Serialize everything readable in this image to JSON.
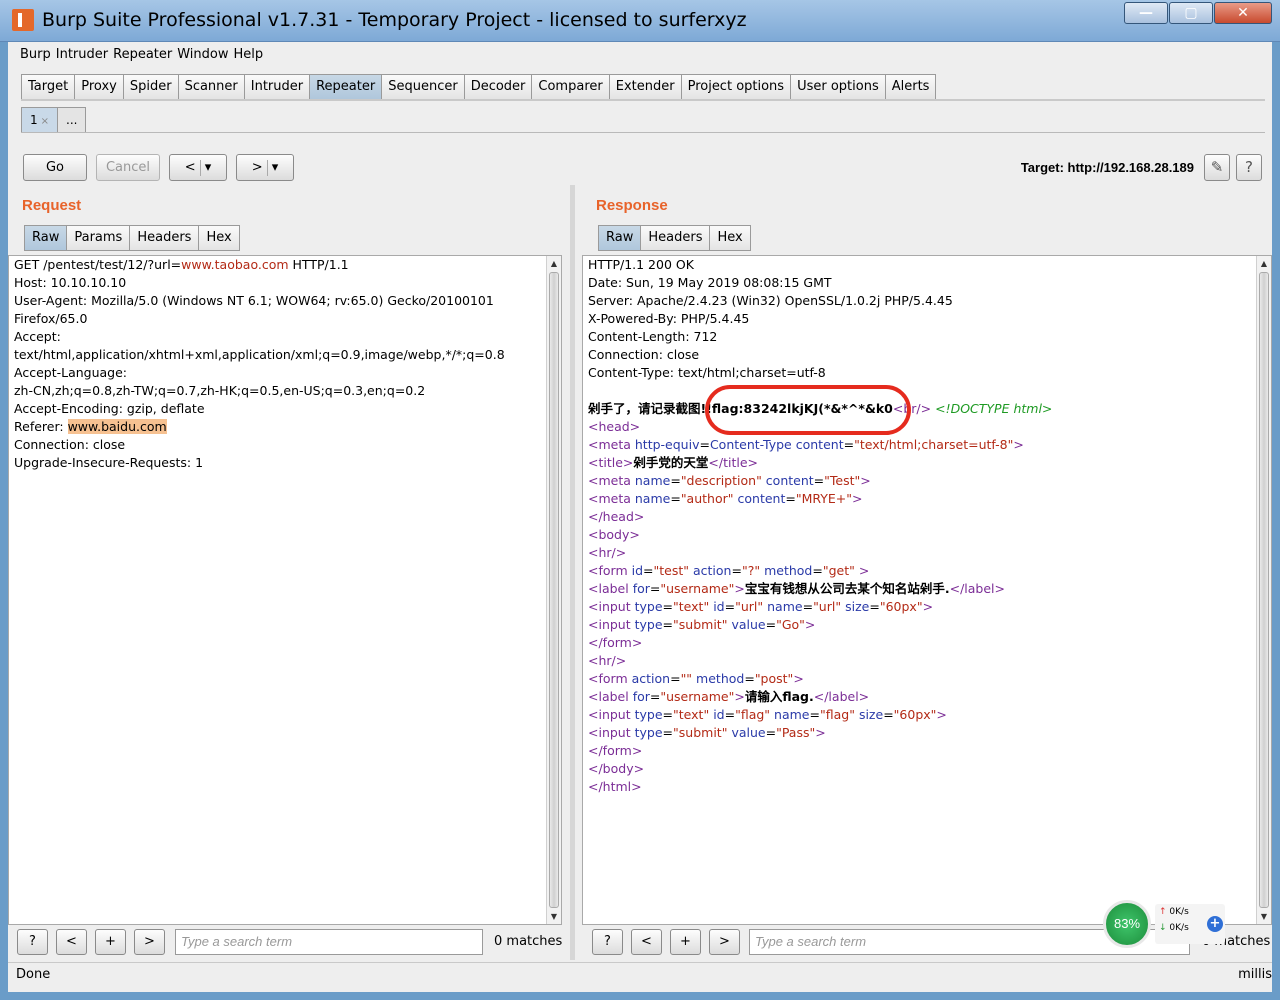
{
  "window": {
    "title": "Burp Suite Professional v1.7.31 - Temporary Project - licensed to surferxyz"
  },
  "menu": [
    "Burp",
    "Intruder",
    "Repeater",
    "Window",
    "Help"
  ],
  "main_tabs": [
    "Target",
    "Proxy",
    "Spider",
    "Scanner",
    "Intruder",
    "Repeater",
    "Sequencer",
    "Decoder",
    "Comparer",
    "Extender",
    "Project options",
    "User options",
    "Alerts"
  ],
  "active_main_tab": "Repeater",
  "sub_tabs": {
    "first": "1",
    "first_close": "×",
    "more": "..."
  },
  "toolbar": {
    "go": "Go",
    "cancel": "Cancel",
    "back": "<",
    "forward": ">",
    "dropdown": "▾",
    "target": "Target: http://192.168.28.189",
    "edit_icon": "✎",
    "help_icon": "?"
  },
  "request": {
    "title": "Request",
    "tabs": [
      "Raw",
      "Params",
      "Headers",
      "Hex"
    ],
    "lines": [
      "GET /pentest/test/12/?url=www.taobao.com HTTP/1.1",
      "Host: 10.10.10.10",
      "User-Agent: Mozilla/5.0 (Windows NT 6.1; WOW64; rv:65.0) Gecko/20100101",
      "Firefox/65.0",
      "Accept:",
      "text/html,application/xhtml+xml,application/xml;q=0.9,image/webp,*/*;q=0.8",
      "Accept-Language:",
      "zh-CN,zh;q=0.8,zh-TW;q=0.7,zh-HK;q=0.5,en-US;q=0.3,en;q=0.2",
      "Accept-Encoding: gzip, deflate",
      "Referer: www.baidu.com",
      "Connection: close",
      "Upgrade-Insecure-Requests: 1"
    ],
    "first_line": {
      "prefix": "GET /pentest/test/12/?url=",
      "param_value": "www.taobao.com",
      "suffix": " HTTP/1.1"
    },
    "referer": {
      "label": "Referer: ",
      "value": "www.baidu.com"
    },
    "search_placeholder": "Type a search term",
    "matches": "0 matches"
  },
  "response": {
    "title": "Response",
    "tabs": [
      "Raw",
      "Headers",
      "Hex"
    ],
    "headers": [
      "HTTP/1.1 200 OK",
      "Date: Sun, 19 May 2019 08:08:15 GMT",
      "Server: Apache/2.4.23 (Win32) OpenSSL/1.0.2j PHP/5.4.45",
      "X-Powered-By: PHP/5.4.45",
      "Content-Length: 712",
      "Connection: close",
      "Content-Type: text/html;charset=utf-8"
    ],
    "flag_line": {
      "cn": "剁手了，请记录截图!!",
      "flag": "flag:83242lkjKJ(*&*^*&k0",
      "br": "<br/>",
      "doctype": "<!DOCTYPE html>"
    },
    "title_text": "剁手党的天堂",
    "label1_text": "宝宝有钱想从公司去某个知名站剁手.",
    "label2_text": "请输入flag.",
    "search_placeholder": "Type a search term",
    "matches": "0 matches"
  },
  "bottom_buttons": {
    "help": "?",
    "prev": "<",
    "add": "+",
    "next": ">"
  },
  "status": {
    "text": "Done",
    "millis": "millis"
  },
  "net_widget": {
    "percent": "83%",
    "up": "0K/s",
    "down": "0K/s",
    "plus": "+"
  },
  "colors": {
    "accent": "#e8632a",
    "active_tab": "#b0c7dc",
    "highlight": "#f6c191",
    "circle": "#e52b1e"
  }
}
